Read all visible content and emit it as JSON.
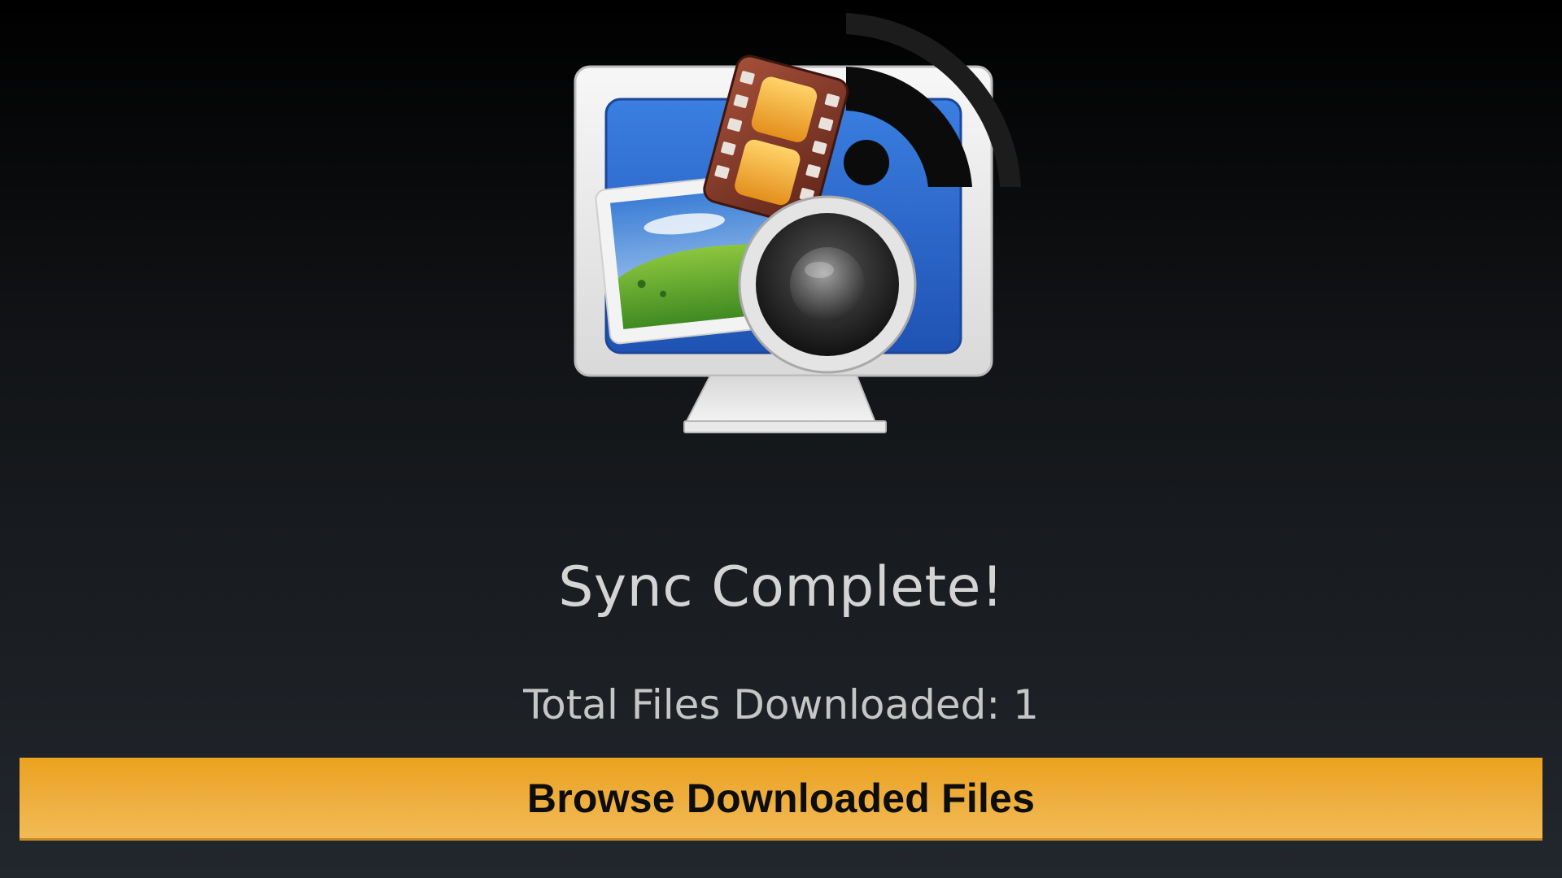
{
  "status": {
    "title": "Sync Complete!",
    "summary": "Total Files Downloaded: 1"
  },
  "actions": {
    "browse_label": "Browse Downloaded Files"
  },
  "illustration": {
    "icons": [
      "monitor-icon",
      "film-strip-icon",
      "wifi-signal-icon",
      "landscape-photo-icon",
      "speaker-icon"
    ]
  },
  "colors": {
    "button_accent": "#eba21f",
    "screen_blue": "#2f6fd0"
  }
}
